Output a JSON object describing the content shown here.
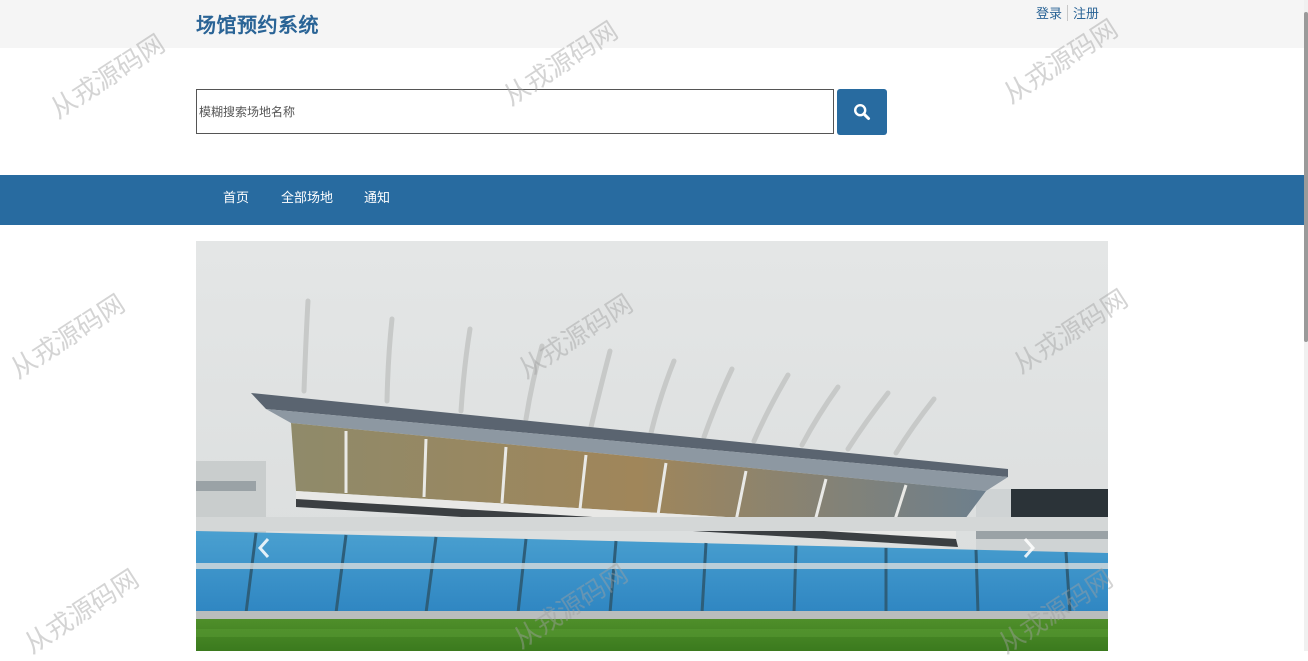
{
  "header": {
    "title": "场馆预约系统",
    "login": "登录",
    "register": "注册"
  },
  "search": {
    "placeholder": "模糊搜索场地名称",
    "value": "",
    "button_icon": "search-icon"
  },
  "nav": {
    "items": [
      {
        "label": "首页"
      },
      {
        "label": "全部场地"
      },
      {
        "label": "通知"
      }
    ]
  },
  "carousel": {
    "image_description": "stadium-grandstand",
    "prev_icon": "chevron-left-icon",
    "next_icon": "chevron-right-icon"
  },
  "watermark": "从戎源码网",
  "colors": {
    "brand": "#286ba0",
    "title": "#2a6496",
    "topbar": "#f5f5f5"
  }
}
